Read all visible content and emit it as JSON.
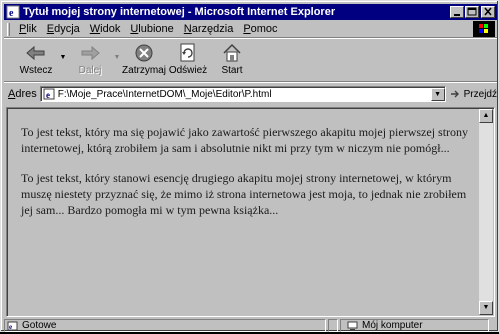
{
  "window": {
    "title": "Tytuł mojej strony internetowej - Microsoft Internet Explorer",
    "controls": {
      "minimize": "_",
      "maximize": "□",
      "close": "×"
    }
  },
  "menu": {
    "items": [
      "Plik",
      "Edycja",
      "Widok",
      "Ulubione",
      "Narzędzia",
      "Pomoc"
    ]
  },
  "toolbar": {
    "buttons": [
      {
        "label": "Wstecz",
        "icon": "back-arrow-icon",
        "enabled": true
      },
      {
        "label": "Dalej",
        "icon": "forward-arrow-icon",
        "enabled": false
      },
      {
        "label": "Zatrzymaj",
        "icon": "stop-icon",
        "enabled": true
      },
      {
        "label": "Odśwież",
        "icon": "refresh-icon",
        "enabled": true
      },
      {
        "label": "Start",
        "icon": "home-icon",
        "enabled": true
      }
    ]
  },
  "address": {
    "label": "Adres",
    "url": "F:\\Moje_Prace\\InternetDOM\\_Moje\\Editor\\P.html",
    "go_label": "Przejdź"
  },
  "page": {
    "paragraphs": [
      "To jest tekst, który ma się pojawić jako zawartość pierwszego akapitu mojej pierwszej strony internetowej, którą zrobiłem ja sam i absolutnie nikt mi przy tym w niczym nie pomógł...",
      "To jest tekst, który stanowi esencję drugiego akapitu mojej strony internetowej, w którym muszę niestety przyznać się, że mimo iż strona internetowa jest moja, to jednak nie zrobiłem jej sam... Bardzo pomogła mi w tym pewna książka..."
    ]
  },
  "status": {
    "text": "Gotowe",
    "zone": "Mój komputer"
  },
  "colors": {
    "titlebar": "#000080",
    "chrome": "#c0c0c0"
  }
}
